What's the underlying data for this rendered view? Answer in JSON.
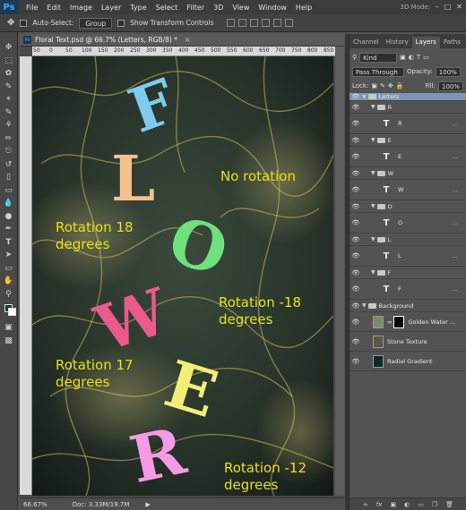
{
  "app": {
    "logo": "Ps"
  },
  "menu": {
    "items": [
      "File",
      "Edit",
      "Image",
      "Layer",
      "Type",
      "Select",
      "Filter",
      "3D",
      "View",
      "Window",
      "Help"
    ],
    "workspace": "3D Mode:"
  },
  "options": {
    "auto_select_label": "Auto-Select:",
    "auto_select_value": "Group",
    "transform_label": "Show Transform Controls"
  },
  "document": {
    "tab_title": "Floral Text.psd @ 66.7% (Letters, RGB/8) *",
    "ruler_ticks": [
      "50",
      "0",
      "50",
      "100",
      "150",
      "200",
      "250",
      "300",
      "350",
      "400",
      "450",
      "500",
      "550",
      "600",
      "650",
      "700",
      "750",
      "800",
      "850"
    ],
    "zoom": "66.67%",
    "doc_size": "Doc: 3.33M/19.7M"
  },
  "canvas": {
    "letters": [
      {
        "char": "F",
        "color": "#7ecbf0"
      },
      {
        "char": "L",
        "color": "#f6c08e"
      },
      {
        "char": "O",
        "color": "#6fe07c"
      },
      {
        "char": "W",
        "color": "#ea5b8c"
      },
      {
        "char": "E",
        "color": "#f3ef74"
      },
      {
        "char": "R",
        "color": "#f59be6"
      }
    ],
    "annotations": {
      "a1": "No rotation",
      "a2_l1": "Rotation 18",
      "a2_l2": "degrees",
      "a3_l1": "Rotation -18",
      "a3_l2": "degrees",
      "a4_l1": "Rotation 17",
      "a4_l2": "degrees",
      "a5_l1": "Rotation -12",
      "a5_l2": "degrees"
    },
    "annotation_color": "#e8e01a"
  },
  "panel": {
    "tabs": [
      "Channel",
      "History",
      "Layers",
      "Paths"
    ],
    "kind": "Kind",
    "blend_mode": "Pass Through",
    "opacity_label": "Opacity:",
    "opacity_value": "100%",
    "lock_label": "Lock:",
    "fill_label": "Fill:",
    "fill_value": "100%",
    "layers": {
      "letters": "Letters",
      "g_r": "R",
      "t_r": "R",
      "g_e": "E",
      "t_e": "E",
      "g_w": "W",
      "t_w": "W",
      "g_o": "O",
      "t_o": "O",
      "g_l": "L",
      "t_l": "L",
      "g_f": "F",
      "t_f": "F",
      "background": "Background",
      "golden": "Golden Water ...",
      "stone": "Stone Texture",
      "radial": "Radial Gradient"
    }
  }
}
